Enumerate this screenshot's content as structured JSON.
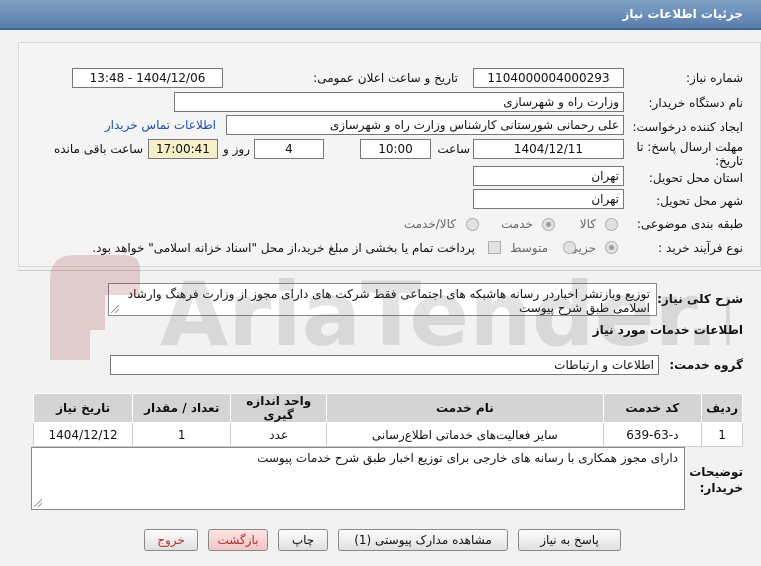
{
  "header": {
    "title": "جزئیات اطلاعات نیاز"
  },
  "form": {
    "need_number_label": "شماره نیاز:",
    "need_number": "1104000004000293",
    "announce_label": "تاریخ و ساعت اعلان عمومی:",
    "announce_value": "1404/12/06 - 13:48",
    "buyer_org_label": "نام دستگاه خریدار:",
    "buyer_org": "وزارت راه و شهرسازی",
    "requester_label": "ایجاد کننده درخواست:",
    "requester": "علی رحمانی شورستانی کارشناس وزارت راه و شهرسازی",
    "contact_link": "اطلاعات تماس خریدار",
    "deadline_label_1": "مهلت ارسال پاسخ: تا",
    "deadline_label_2": "تاریخ:",
    "deadline_date": "1404/12/11",
    "time_label": "ساعت",
    "deadline_time": "10:00",
    "days_value": "4",
    "days_label": "روز و",
    "remaining_time": "17:00:41",
    "remaining_label": "ساعت باقی مانده",
    "province_label": "استان محل تحویل:",
    "province": "تهران",
    "city_label": "شهر محل تحویل:",
    "city": "تهران",
    "category_label": "طبقه بندی موضوعی:",
    "category_options": [
      "کالا",
      "خدمت",
      "کالا/خدمت"
    ],
    "category_selected": "خدمت",
    "process_label": "نوع فرآیند خرید :",
    "process_options": [
      "جزیی",
      "متوسط"
    ],
    "process_selected": "جزیی",
    "payment_note": "پرداخت تمام یا بخشی از مبلغ خرید،از محل \"اسناد خزانه اسلامی\" خواهد بود."
  },
  "description": {
    "label": "شرح کلی نیاز:",
    "text": "توزیع وبازنشر اخباردر رسانه هاشبکه های اجتماعی فقط شرکت های دارای مجوز از وزارت فرهنگ وارشاد اسلامی طبق شرح پیوست"
  },
  "services": {
    "section_title": "اطلاعات خدمات مورد نیاز",
    "group_label": "گروه خدمت:",
    "group_value": "اطلاعات و ارتباطات",
    "columns": [
      "ردیف",
      "کد خدمت",
      "نام خدمت",
      "واحد اندازه گیری",
      "تعداد / مقدار",
      "تاریخ نیاز"
    ],
    "rows": [
      [
        "1",
        "د-63-639",
        "سایر فعالیت‌های خدماتی اطلاع‌رسانی",
        "عدد",
        "1",
        "1404/12/12"
      ]
    ]
  },
  "buyer_notes": {
    "label_1": "توضیحات",
    "label_2": "خریدار:",
    "text": "دارای مجوز همکاری با رسانه های خارجی برای  توزیع اخبار طبق شرح خدمات پیوست"
  },
  "buttons": {
    "reply": "پاسخ به نیاز",
    "attachments": "مشاهده مدارک پیوستی (1)",
    "print": "چاپ",
    "back": "بازگشت",
    "exit": "خروج"
  },
  "watermark": {
    "brand": "AriaTender.neT"
  },
  "colors": {
    "header": "#5a7fae",
    "link": "#1f4fb4",
    "exit_text": "#b03030",
    "timer_bg": "#f6efc7"
  }
}
